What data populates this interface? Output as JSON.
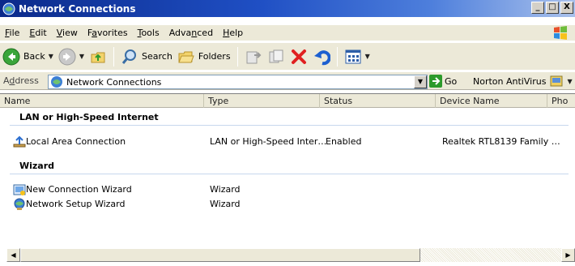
{
  "window": {
    "title": "Network Connections",
    "caption_buttons": [
      "_",
      "□",
      "X"
    ]
  },
  "menu": [
    {
      "label": "File",
      "accel": "F",
      "rest": "ile"
    },
    {
      "label": "Edit",
      "accel": "E",
      "rest": "dit"
    },
    {
      "label": "View",
      "accel": "V",
      "rest": "iew"
    },
    {
      "label": "Favorites",
      "accel": "a",
      "pre": "F",
      "rest": "vorites"
    },
    {
      "label": "Tools",
      "accel": "T",
      "rest": "ools"
    },
    {
      "label": "Advanced",
      "pre": "Adva",
      "accel": "n",
      "rest": "ced"
    },
    {
      "label": "Help",
      "accel": "H",
      "rest": "elp"
    }
  ],
  "toolbar": {
    "back_label": "Back",
    "search_label": "Search",
    "folders_label": "Folders"
  },
  "address": {
    "label_pre": "A",
    "label_accel": "d",
    "label_rest": "dress",
    "value": "Network Connections",
    "go_label": "Go",
    "norton_label": "Norton AntiVirus"
  },
  "columns": [
    "Name",
    "Type",
    "Status",
    "Device Name",
    "Pho"
  ],
  "groups": [
    {
      "title": "LAN or High-Speed Internet",
      "items": [
        {
          "name": "Local Area Connection",
          "type": "LAN or High-Speed Inter…",
          "status": "Enabled",
          "device": "Realtek RTL8139 Family …",
          "icon": "network-connection-icon"
        }
      ]
    },
    {
      "title": "Wizard",
      "items": [
        {
          "name": "New Connection Wizard",
          "type": "Wizard",
          "status": "",
          "device": "",
          "icon": "new-connection-wizard-icon"
        },
        {
          "name": "Network Setup Wizard",
          "type": "Wizard",
          "status": "",
          "device": "",
          "icon": "network-setup-wizard-icon"
        }
      ]
    }
  ],
  "colors": {
    "title_gradient_start": "#0b2a8a",
    "title_gradient_end": "#a9c1ec",
    "chrome": "#ece9d8"
  }
}
